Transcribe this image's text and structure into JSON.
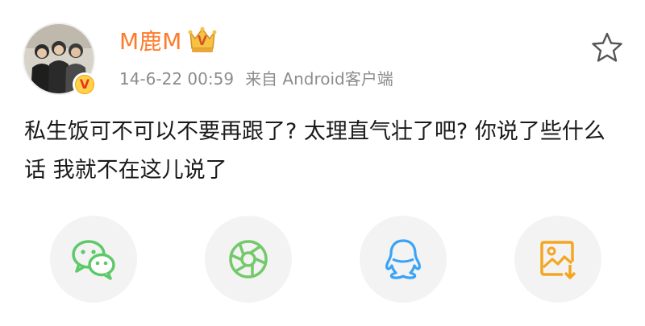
{
  "post": {
    "username": "M鹿M",
    "timestamp": "14-6-22 00:59",
    "source": "来自 Android客户端",
    "text": "私生饭可不可以不要再跟了? 太理直气壮了吧? 你说了些什么话 我就不在这儿说了"
  },
  "icons": {
    "avatar": "avatar-photo",
    "verified": "verified-v-badge",
    "vip": "vip-crown-icon",
    "star": "star-outline-icon",
    "share": [
      "wechat-icon",
      "moments-icon",
      "qq-icon",
      "save-image-icon"
    ]
  },
  "colors": {
    "username": "#ff7a2b",
    "verified": "#f2a20c",
    "wechat": "#5dc969",
    "moments": "#74c96a",
    "qq": "#3aa3f5",
    "save": "#f4a623"
  }
}
